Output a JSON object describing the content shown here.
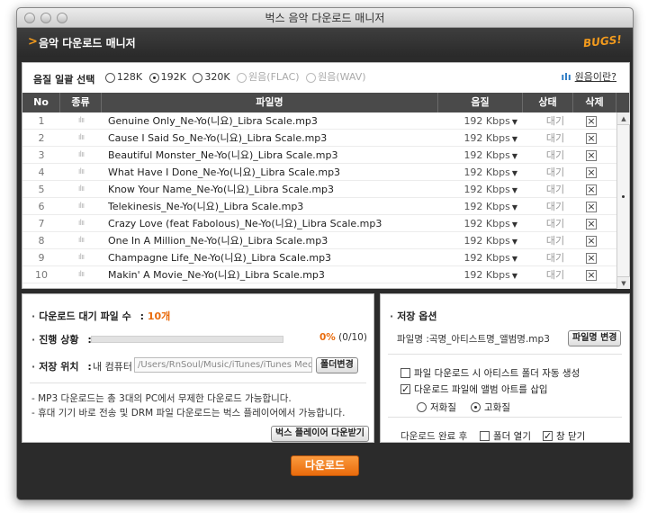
{
  "window": {
    "title": "벅스 음악 다운로드 매니저"
  },
  "header": {
    "arrow": ">",
    "title": "음악 다운로드 매니저",
    "logo": "BUGS!"
  },
  "quality": {
    "label": "음질 일괄 선택",
    "options": [
      {
        "label": "128K",
        "selected": false,
        "enabled": true
      },
      {
        "label": "192K",
        "selected": true,
        "enabled": true
      },
      {
        "label": "320K",
        "selected": false,
        "enabled": true
      },
      {
        "label": "원음(FLAC)",
        "selected": false,
        "enabled": false
      },
      {
        "label": "원음(WAV)",
        "selected": false,
        "enabled": false
      }
    ],
    "what_link": "원음이란?"
  },
  "table": {
    "headers": {
      "no": "No",
      "kind": "종류",
      "name": "파일명",
      "quality": "음질",
      "status": "상태",
      "delete": "삭제"
    },
    "rows": [
      {
        "no": "1",
        "name": "Genuine Only_Ne-Yo(니요)_Libra Scale.mp3",
        "quality": "192 Kbps",
        "status": "대기"
      },
      {
        "no": "2",
        "name": "Cause I Said So_Ne-Yo(니요)_Libra Scale.mp3",
        "quality": "192 Kbps",
        "status": "대기"
      },
      {
        "no": "3",
        "name": "Beautiful Monster_Ne-Yo(니요)_Libra Scale.mp3",
        "quality": "192 Kbps",
        "status": "대기"
      },
      {
        "no": "4",
        "name": "What Have I Done_Ne-Yo(니요)_Libra Scale.mp3",
        "quality": "192 Kbps",
        "status": "대기"
      },
      {
        "no": "5",
        "name": "Know Your Name_Ne-Yo(니요)_Libra Scale.mp3",
        "quality": "192 Kbps",
        "status": "대기"
      },
      {
        "no": "6",
        "name": "Telekinesis_Ne-Yo(니요)_Libra Scale.mp3",
        "quality": "192 Kbps",
        "status": "대기"
      },
      {
        "no": "7",
        "name": "Crazy Love (feat Fabolous)_Ne-Yo(니요)_Libra Scale.mp3",
        "quality": "192 Kbps",
        "status": "대기"
      },
      {
        "no": "8",
        "name": "One In A Million_Ne-Yo(니요)_Libra Scale.mp3",
        "quality": "192 Kbps",
        "status": "대기"
      },
      {
        "no": "9",
        "name": "Champagne Life_Ne-Yo(니요)_Libra Scale.mp3",
        "quality": "192 Kbps",
        "status": "대기"
      },
      {
        "no": "10",
        "name": "Makin' A Movie_Ne-Yo(니요)_Libra Scale.mp3",
        "quality": "192 Kbps",
        "status": "대기"
      }
    ]
  },
  "status": {
    "waiting_label": "다운로드 대기 파일 수",
    "waiting_sep": ":",
    "waiting_value": "10개",
    "progress_label": "진행 상황",
    "progress_sep": ":",
    "progress_percent": "0%",
    "progress_count": "(0/10)",
    "progress_fraction": 0,
    "location_label": "저장 위치",
    "location_sep": ":",
    "location_name": "내 컴퓨터",
    "location_path": "/Users/RnSoul/Music/iTunes/iTunes Media/",
    "folder_button": "폴더변경",
    "notes": [
      "- MP3 다운로드는 총 3대의 PC에서 무제한 다운로드 가능합니다.",
      "- 휴대 기기 바로 전송 및 DRM 파일 다운로드는 벅스 플레이어에서 가능합니다."
    ],
    "player_button": "벅스 플레이어 다운받기"
  },
  "options": {
    "title": "저장 옵션",
    "filename_label": "파일명 :",
    "filename_value": "곡명_아티스트명_앨범명.mp3",
    "filename_button": "파일명 변경",
    "artist_folder": {
      "label": "파일 다운로드 시 아티스트 폴더 자동 생성",
      "checked": false
    },
    "album_art": {
      "label": "다운로드 파일에 앨범 아트를 삽입",
      "checked": true
    },
    "low_quality": {
      "label": "저화질",
      "selected": false
    },
    "high_quality": {
      "label": "고화질",
      "selected": true
    },
    "after_label": "다운로드 완료 후",
    "open_folder": {
      "label": "폴더 열기",
      "checked": false
    },
    "close_window": {
      "label": "창 닫기",
      "checked": true
    }
  },
  "footer": {
    "download_button": "다운로드"
  },
  "colors": {
    "accent": "#e96b0c",
    "header_bg": "#2b2b2b",
    "link_blue": "#2b7bc4"
  }
}
